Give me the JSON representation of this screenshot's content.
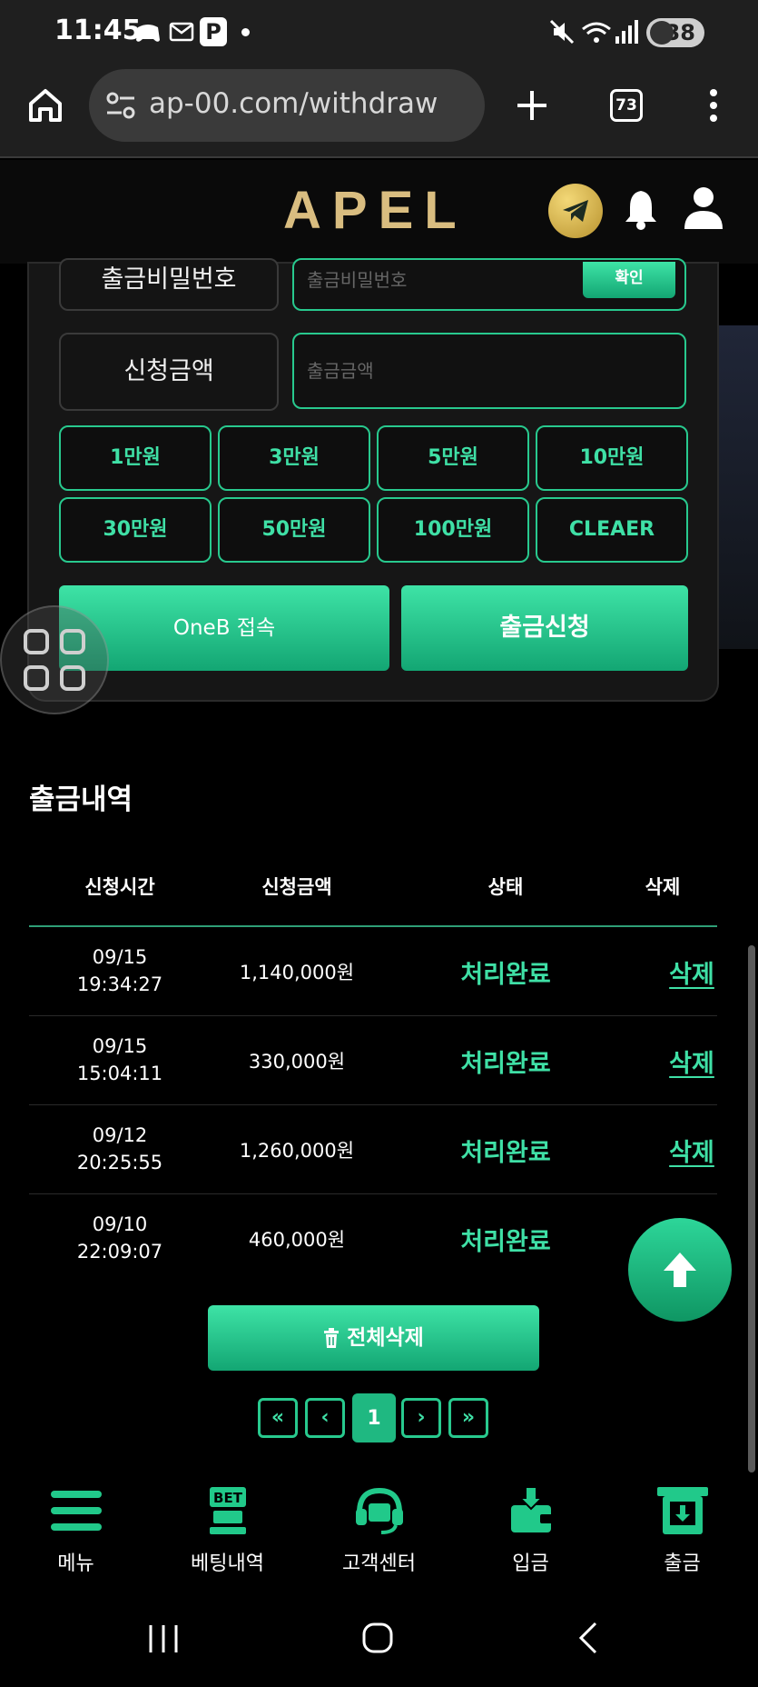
{
  "status_bar": {
    "time": "11:45",
    "battery": "38"
  },
  "browser": {
    "url": "ap-00.com/withdraw",
    "tab_count": "73"
  },
  "app": {
    "logo": "APEL"
  },
  "form": {
    "password_label": "출금비밀번호",
    "password_placeholder": "출금비밀번호",
    "confirm_label": "확인",
    "amount_label": "신청금액",
    "amount_placeholder": "출금금액",
    "quick_amounts": [
      "1만원",
      "3만원",
      "5만원",
      "10만원",
      "30만원",
      "50만원",
      "100만원",
      "CLEAER"
    ],
    "oneb_label": "OneB 접속",
    "submit_label": "출금신청"
  },
  "history": {
    "title": "출금내역",
    "headers": [
      "신청시간",
      "신청금액",
      "상태",
      "삭제"
    ],
    "rows": [
      {
        "date": "09/15",
        "time": "19:34:27",
        "amount": "1,140,000원",
        "status": "처리완료",
        "delete": "삭제"
      },
      {
        "date": "09/15",
        "time": "15:04:11",
        "amount": "330,000원",
        "status": "처리완료",
        "delete": "삭제"
      },
      {
        "date": "09/12",
        "time": "20:25:55",
        "amount": "1,260,000원",
        "status": "처리완료",
        "delete": "삭제"
      },
      {
        "date": "09/10",
        "time": "22:09:07",
        "amount": "460,000원",
        "status": "처리완료",
        "delete": ""
      }
    ],
    "delete_all_label": "전체삭제"
  },
  "pagination": {
    "first": "«",
    "prev": "‹",
    "current": "1",
    "next": "›",
    "last": "»"
  },
  "bottom_nav": [
    {
      "label": "메뉴",
      "icon": "hamburger-menu-icon"
    },
    {
      "label": "베팅내역",
      "icon": "bet-history-icon"
    },
    {
      "label": "고객센터",
      "icon": "headset-icon"
    },
    {
      "label": "입금",
      "icon": "deposit-wallet-icon"
    },
    {
      "label": "출금",
      "icon": "withdraw-icon"
    }
  ],
  "colors": {
    "accent": "#28c98e",
    "accent_text": "#3fe0a6",
    "logo_gold": "#d9bd80",
    "background": "#000000"
  }
}
